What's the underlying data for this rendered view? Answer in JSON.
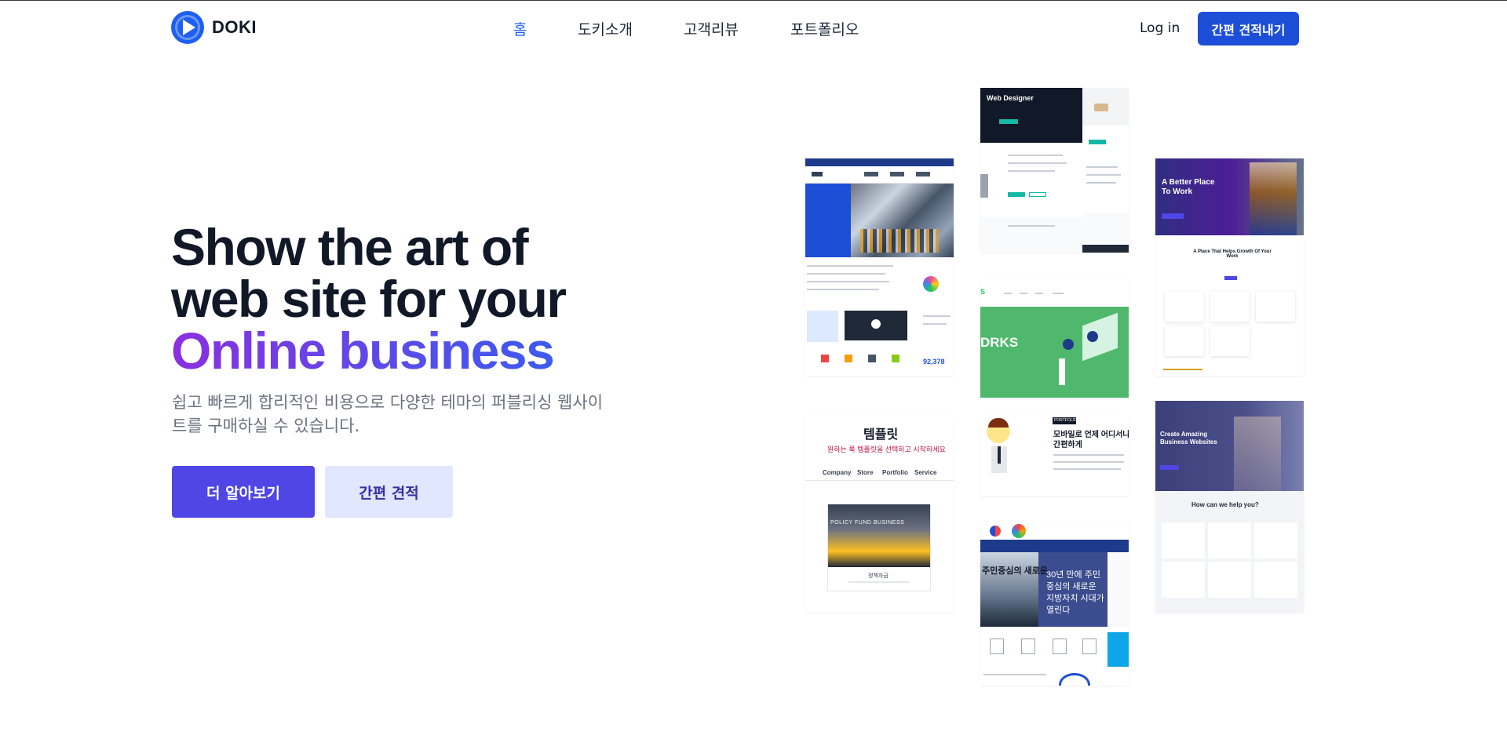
{
  "header": {
    "logo_text": "DOKI",
    "nav": [
      {
        "label": "홈",
        "active": true
      },
      {
        "label": "도키소개",
        "active": false
      },
      {
        "label": "고객리뷰",
        "active": false
      },
      {
        "label": "포트폴리오",
        "active": false
      }
    ],
    "login_label": "Log in",
    "quote_button_label": "간편 견적내기"
  },
  "hero": {
    "title_line1": "Show the art of",
    "title_line2": "web site for your",
    "title_line3": "Online business",
    "subtitle": "쉽고 빠르게 합리적인 비용으로 다양한 테마의 퍼블리싱 웹사이트를 구매하실 수 있습니다.",
    "primary_button": "더 알아보기",
    "secondary_button": "간편 견적"
  },
  "gallery": {
    "thumb_webdesigner_title": "Web Designer",
    "thumb_works_text": "DRKS",
    "thumb_mobile_tag": "PORTFOLIO",
    "thumb_mobile_title": "모바일로 언제 어디서나",
    "thumb_mobile_title2": "간편하게",
    "thumb_template_title": "템플릿",
    "thumb_template_sub": "원하는 룩 템플릿을 선택하고 시작하세요",
    "thumb_template_tabs": [
      "Company",
      "Store",
      "Portfolio",
      "Service"
    ],
    "thumb_template_banner": "POLICY FUND BUSINESS",
    "thumb_template_caption": "정책자금",
    "thumb_korea_text": "30년 만에 주민중심의 새로운 지방자치 시대가 열린다",
    "thumb_korea_side": "주민중심의 새로운",
    "thumb_betterplace_title": "A Better Place To Work",
    "thumb_betterplace_sub": "A Place That Helps Growth Of Your Work",
    "thumb_amazing_title": "Create Amazing Business Websites",
    "thumb_amazing_help": "How can we help you?"
  },
  "colors": {
    "brand_blue": "#1d4ed8",
    "primary_indigo": "#4f46e5",
    "secondary_indigo_bg": "#e0e7ff",
    "gradient_start": "#8b2fe0",
    "gradient_end": "#3b5bf0",
    "nav_active": "#2563eb"
  },
  "icons": [
    "play-logo-icon"
  ]
}
